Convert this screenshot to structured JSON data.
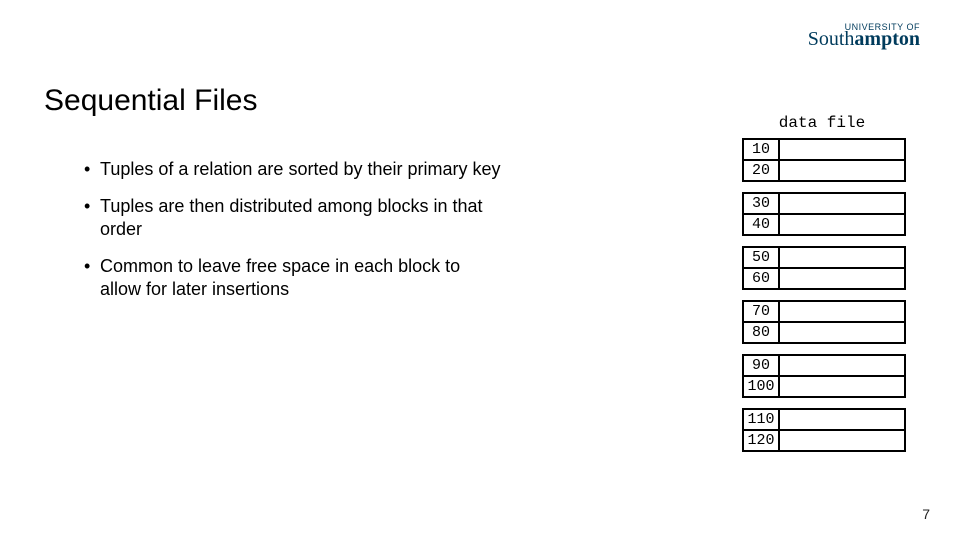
{
  "logo": {
    "top": "UNIVERSITY OF",
    "main_light": "South",
    "main_bold": "ampton"
  },
  "title": "Sequential Files",
  "bullets": [
    "Tuples of a relation are sorted by their primary key",
    "Tuples are then distributed among blocks in that order",
    "Common to leave free space in each block to allow for later insertions"
  ],
  "datafile": {
    "label": "data file",
    "blocks": [
      [
        "10",
        "20"
      ],
      [
        "30",
        "40"
      ],
      [
        "50",
        "60"
      ],
      [
        "70",
        "80"
      ],
      [
        "90",
        "100"
      ],
      [
        "110",
        "120"
      ]
    ]
  },
  "page_number": "7"
}
